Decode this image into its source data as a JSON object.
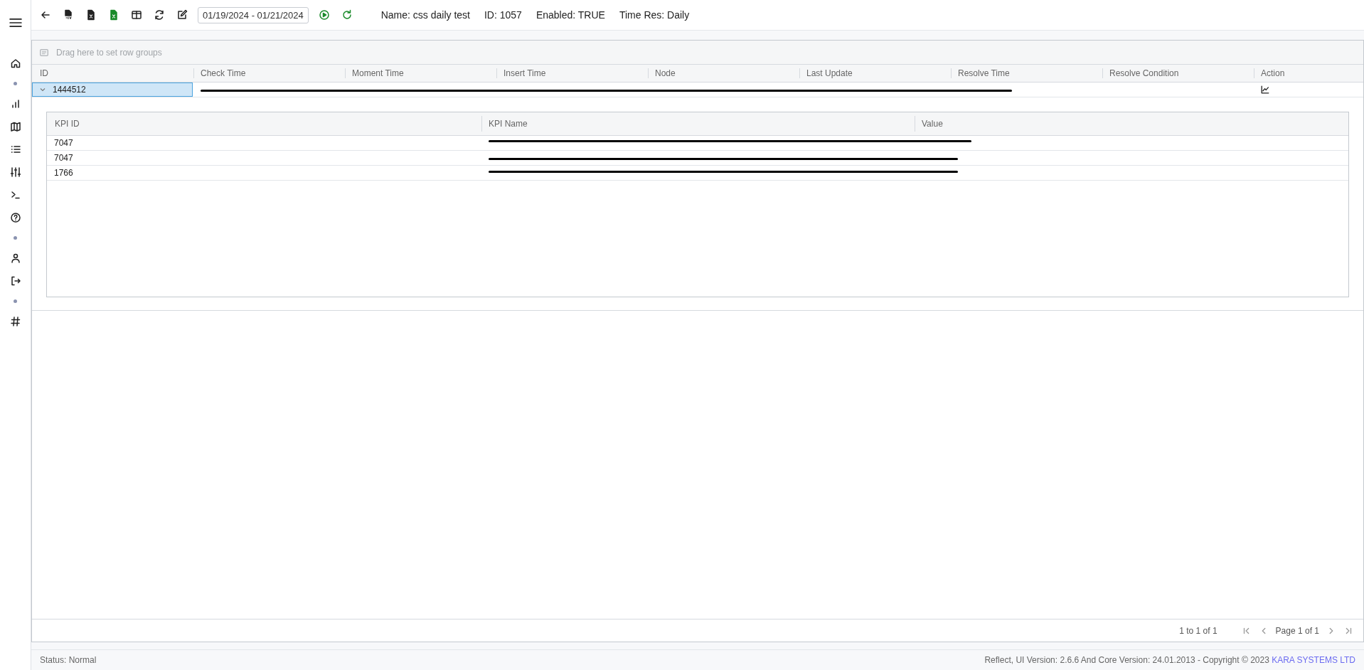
{
  "toolbar": {
    "date_range": "01/19/2024 - 01/21/2024",
    "info": [
      "Name: css daily test",
      "ID: 1057",
      "Enabled: TRUE",
      "Time Res: Daily"
    ]
  },
  "grid": {
    "group_hint": "Drag here to set row groups",
    "columns": [
      "ID",
      "Check Time",
      "Moment Time",
      "Insert Time",
      "Node",
      "Last Update",
      "Resolve Time",
      "Resolve Condition",
      "Action"
    ],
    "rows": [
      {
        "selected": true,
        "expanded": true,
        "redacted": true,
        "cells": [
          "1444512"
        ],
        "detail": {
          "columns": [
            "KPI ID",
            "KPI Name",
            "Value"
          ],
          "rows": [
            {
              "redacted": true,
              "cells": [
                "7047"
              ]
            },
            {
              "redacted": true,
              "cells": [
                "7047"
              ]
            },
            {
              "redacted": true,
              "cells": [
                "1766"
              ]
            }
          ]
        }
      }
    ],
    "pager": {
      "summary": "1 to 1 of 1",
      "page": "Page 1 of 1"
    }
  },
  "status_bar": {
    "status": "Status: Normal",
    "version": "Reflect, UI Version: 2.6.6 And Core Version: 24.01.2013 - Copyright © 2023",
    "company_link": "KARA SYSTEMS LTD"
  }
}
